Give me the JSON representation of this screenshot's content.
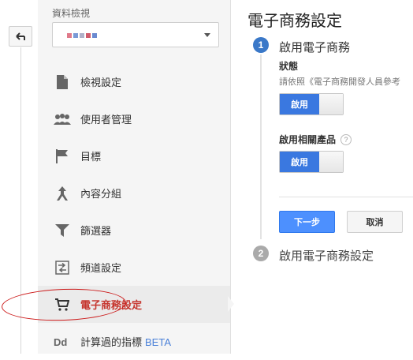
{
  "nav": {
    "back_icon": "back-arrow-icon"
  },
  "sidebar": {
    "view_label": "資料檢視",
    "view_select": {
      "value_obscured": true,
      "dot_colors": [
        "#e07a8a",
        "#7a9ad6",
        "#b0b0c8",
        "#d05a6a",
        "#6a8ad0"
      ]
    },
    "items": [
      {
        "label": "檢視設定",
        "icon": "document-icon"
      },
      {
        "label": "使用者管理",
        "icon": "users-icon"
      },
      {
        "label": "目標",
        "icon": "flag-icon"
      },
      {
        "label": "內容分組",
        "icon": "content-grouping-icon"
      },
      {
        "label": "篩選器",
        "icon": "filter-icon"
      },
      {
        "label": "頻道設定",
        "icon": "channel-settings-icon"
      },
      {
        "label": "電子商務設定",
        "icon": "cart-icon",
        "active": true
      },
      {
        "label": "計算過的指標",
        "icon": "dd-icon",
        "badge": "BETA"
      }
    ]
  },
  "main": {
    "title": "電子商務設定",
    "step1": {
      "number": "1",
      "title": "啟用電子商務",
      "status_label": "狀態",
      "status_desc": "請依照《電子商務開發人員參考",
      "toggle_on_label": "啟用",
      "related_label": "啟用相關產品",
      "help_icon": "?",
      "toggle2_on_label": "啟用",
      "next_button": "下一步",
      "cancel_button": "取消"
    },
    "step2": {
      "number": "2",
      "title": "啟用電子商務設定"
    }
  },
  "colors": {
    "accent_blue": "#4d90fe",
    "active_red": "#c6372f",
    "annotation_red": "#cc1a1a"
  }
}
